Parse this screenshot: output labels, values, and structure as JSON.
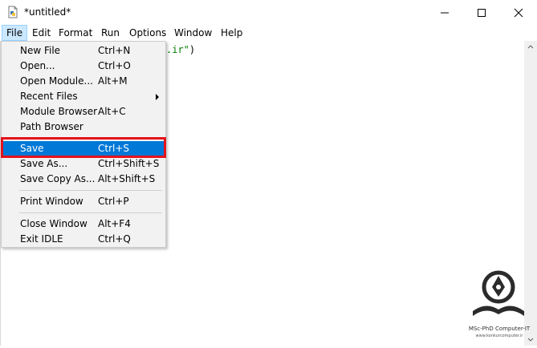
{
  "window": {
    "title": "*untitled*"
  },
  "menubar": [
    "File",
    "Edit",
    "Format",
    "Run",
    "Options",
    "Window",
    "Help"
  ],
  "editor": {
    "code_fragment": ".ir\"",
    "closing_paren": ")"
  },
  "file_menu": {
    "groups": [
      [
        {
          "label": "New File",
          "accel": "Ctrl+N"
        },
        {
          "label": "Open...",
          "accel": "Ctrl+O"
        },
        {
          "label": "Open Module...",
          "accel": "Alt+M"
        },
        {
          "label": "Recent Files",
          "accel": ""
        },
        {
          "label": "Module Browser",
          "accel": "Alt+C"
        },
        {
          "label": "Path Browser",
          "accel": ""
        }
      ],
      [
        {
          "label": "Save",
          "accel": "Ctrl+S"
        },
        {
          "label": "Save As...",
          "accel": "Ctrl+Shift+S"
        },
        {
          "label": "Save Copy As...",
          "accel": "Alt+Shift+S"
        }
      ],
      [
        {
          "label": "Print Window",
          "accel": "Ctrl+P"
        }
      ],
      [
        {
          "label": "Close Window",
          "accel": "Alt+F4"
        },
        {
          "label": "Exit IDLE",
          "accel": "Ctrl+Q"
        }
      ]
    ]
  },
  "watermark": {
    "line1": "MSc-PhD Computer-IT",
    "line2": "www.konkurcomputer.ir"
  },
  "colors": {
    "selection": "#0078d7",
    "highlight_border": "#e3131b",
    "menu_active": "#cce8ff"
  }
}
